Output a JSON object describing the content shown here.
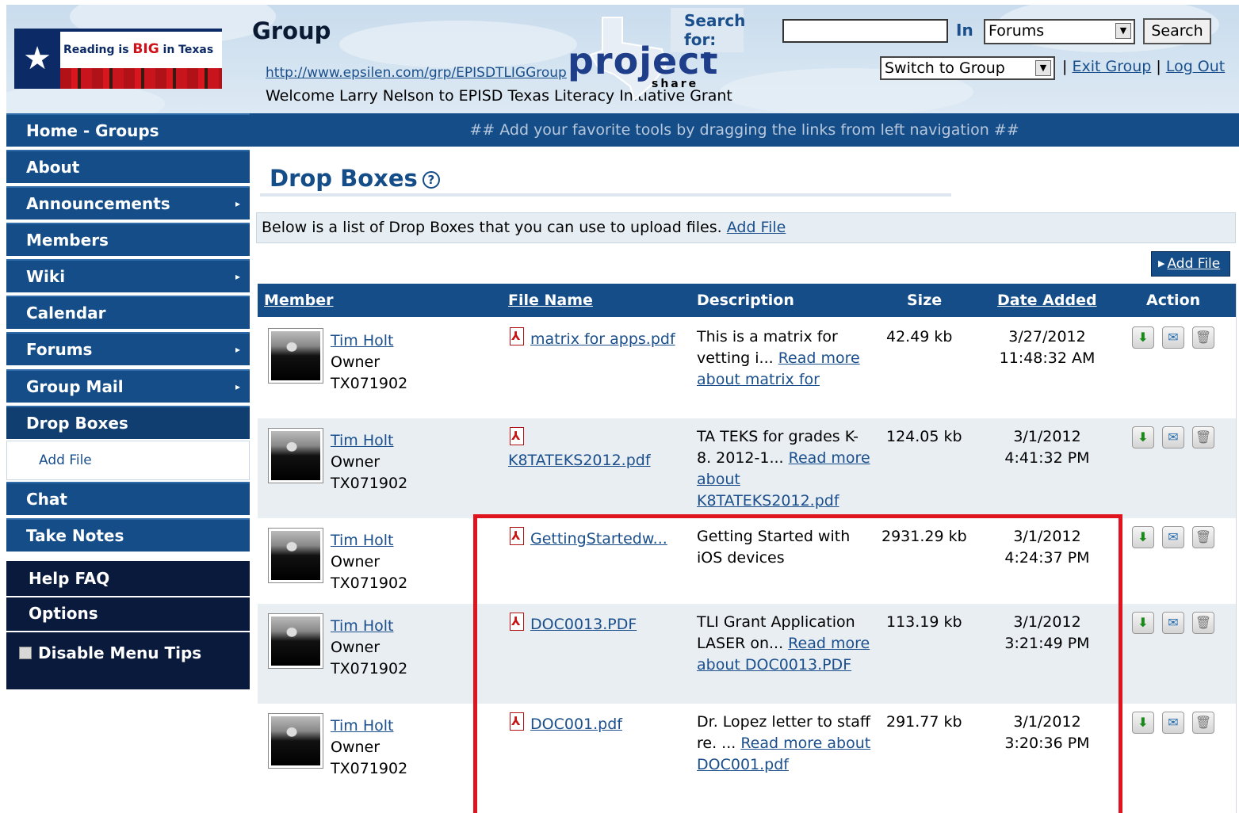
{
  "header": {
    "logo_text_prefix": "Reading is ",
    "logo_text_big": "BIG",
    "logo_text_suffix": " in Texas",
    "group_title": "Group",
    "group_url": "http://www.epsilen.com/grp/EPISDTLIGGroup",
    "welcome": "Welcome Larry Nelson to EPISD Texas Literacy Initiative Grant",
    "brand": "project",
    "brand_sub": "share",
    "search_label": "Search for:",
    "search_value": "",
    "in_label": "In",
    "search_scope": "Forums",
    "search_button": "Search",
    "switch_group": "Switch to Group",
    "exit_group": "Exit Group",
    "log_out": "Log Out"
  },
  "sidebar": {
    "items": [
      {
        "label": "Home - Groups",
        "arrow": false
      },
      {
        "label": "About",
        "arrow": false
      },
      {
        "label": "Announcements",
        "arrow": true
      },
      {
        "label": "Members",
        "arrow": false
      },
      {
        "label": "Wiki",
        "arrow": true
      },
      {
        "label": "Calendar",
        "arrow": false
      },
      {
        "label": "Forums",
        "arrow": true
      },
      {
        "label": "Group Mail",
        "arrow": true
      },
      {
        "label": "Drop Boxes",
        "arrow": false
      }
    ],
    "sub_item": "Add File",
    "items_after": [
      {
        "label": "Chat"
      },
      {
        "label": "Take Notes"
      }
    ],
    "help_faq": "Help FAQ",
    "options": "Options",
    "disable_tips": "Disable Menu Tips"
  },
  "banner": "## Add your favorite tools by dragging the links from left navigation ##",
  "main": {
    "heading": "Drop Boxes",
    "help_glyph": "?",
    "info_text": "Below is a list of Drop Boxes that you can use to upload files.",
    "info_link": "Add File",
    "add_file_button": "Add File"
  },
  "table": {
    "headers": {
      "member": "Member",
      "file_name": "File Name",
      "description": "Description",
      "size": "Size",
      "date_added": "Date Added",
      "action": "Action"
    },
    "rows": [
      {
        "member_name": "Tim Holt",
        "member_role": "Owner",
        "member_id": "TX071902",
        "file_name": "matrix for apps.pdf",
        "desc_text": "This is a matrix for vetting i...",
        "desc_link": "Read more about matrix for",
        "size": "42.49 kb",
        "date": "3/27/2012",
        "time": "11:48:32 AM"
      },
      {
        "member_name": "Tim Holt",
        "member_role": "Owner",
        "member_id": "TX071902",
        "file_name": "K8TATEKS2012.pdf",
        "desc_text": "TA TEKS for grades K-8. 2012-1...",
        "desc_link": "Read more about K8TATEKS2012.pdf",
        "size": "124.05 kb",
        "date": "3/1/2012",
        "time": "4:41:32 PM"
      },
      {
        "member_name": "Tim Holt",
        "member_role": "Owner",
        "member_id": "TX071902",
        "file_name": "GettingStartedw...",
        "desc_text": "Getting Started with iOS devices",
        "desc_link": "",
        "size": "2931.29 kb",
        "date": "3/1/2012",
        "time": "4:24:37 PM"
      },
      {
        "member_name": "Tim Holt",
        "member_role": "Owner",
        "member_id": "TX071902",
        "file_name": "DOC0013.PDF",
        "desc_text": "TLI Grant Application LASER on...",
        "desc_link": "Read more about DOC0013.PDF",
        "size": "113.19 kb",
        "date": "3/1/2012",
        "time": "3:21:49 PM"
      },
      {
        "member_name": "Tim Holt",
        "member_role": "Owner",
        "member_id": "TX071902",
        "file_name": "DOC001.pdf",
        "desc_text": "Dr. Lopez letter to staff re. ...",
        "desc_link": "Read more about DOC001.pdf",
        "size": "291.77 kb",
        "date": "3/1/2012",
        "time": "3:20:36 PM"
      }
    ]
  },
  "icons": {
    "download": "download-icon",
    "send": "send-mail-icon",
    "delete": "trash-icon",
    "pdf": "pdf-icon"
  },
  "colors": {
    "nav_blue": "#154d89",
    "dark_nav": "#0a1a3c",
    "link": "#1a4f8c",
    "highlight": "#e0141e"
  }
}
